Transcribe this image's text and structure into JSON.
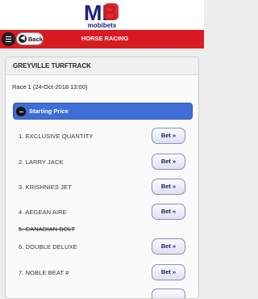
{
  "brand": {
    "logo_mark": "MB",
    "logo_text": "mobibets"
  },
  "nav": {
    "menu_icon": "menu-icon",
    "back_label": "Back",
    "title": "HORSE RACING"
  },
  "card": {
    "header": "GREYVILLE TURFTRACK",
    "race": "Race 1 (24-Oct-2018 13:00)"
  },
  "starting_price": {
    "label": "Starting Price",
    "icon": "minus-circle-icon"
  },
  "bet_label": "Bet »",
  "runners": [
    {
      "name": "1. EXCLUSIVE QUANTITY",
      "scratched": false
    },
    {
      "name": "2. LARRY JACK",
      "scratched": false
    },
    {
      "name": "3. KRISHNIES JET",
      "scratched": false
    },
    {
      "name": "4. AEGEAN AIRE",
      "scratched": false
    },
    {
      "name": "5. CANADIAN BOLT",
      "scratched": true
    },
    {
      "name": "6. DOUBLE DELUXE",
      "scratched": false
    },
    {
      "name": "7. NOBLE BEAT #",
      "scratched": false
    }
  ],
  "colors": {
    "nav": "#d91b21",
    "accent": "#3f6fd6",
    "brand_blue": "#1a237e"
  }
}
